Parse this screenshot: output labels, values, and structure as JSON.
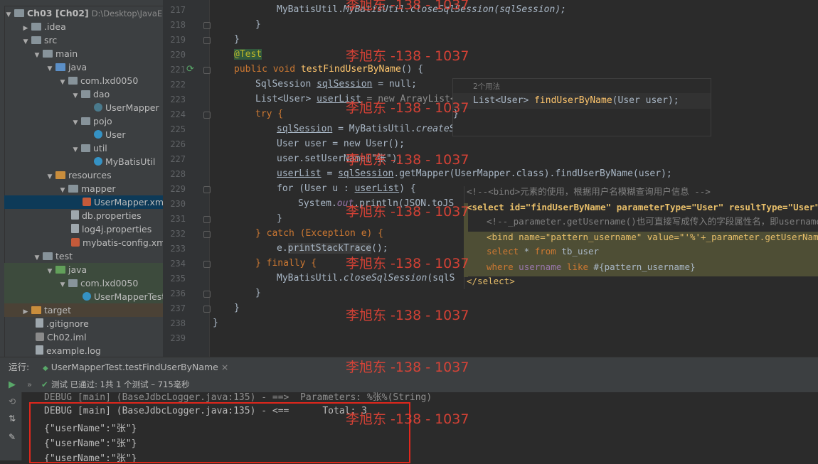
{
  "project_tree": {
    "root": {
      "name": "Ch03 [Ch02]",
      "path": "D:\\Desktop\\JavaEE\\"
    },
    "items": [
      {
        "label": ".idea"
      },
      {
        "label": "src"
      },
      {
        "label": "main"
      },
      {
        "label": "java"
      },
      {
        "label": "com.lxd0050"
      },
      {
        "label": "dao"
      },
      {
        "label": "UserMapper"
      },
      {
        "label": "pojo"
      },
      {
        "label": "User"
      },
      {
        "label": "util"
      },
      {
        "label": "MyBatisUtil"
      },
      {
        "label": "resources"
      },
      {
        "label": "mapper"
      },
      {
        "label": "UserMapper.xml"
      },
      {
        "label": "db.properties"
      },
      {
        "label": "log4j.properties"
      },
      {
        "label": "mybatis-config.xml"
      },
      {
        "label": "test"
      },
      {
        "label": "java"
      },
      {
        "label": "com.lxd0050"
      },
      {
        "label": "UserMapperTest"
      },
      {
        "label": "target"
      },
      {
        "label": ".gitignore"
      },
      {
        "label": "Ch02.iml"
      },
      {
        "label": "example.log"
      }
    ]
  },
  "editor": {
    "line_numbers": [
      "217",
      "218",
      "219",
      "220",
      "221",
      "222",
      "223",
      "224",
      "225",
      "226",
      "227",
      "228",
      "229",
      "230",
      "231",
      "232",
      "233",
      "234",
      "235",
      "236",
      "237",
      "238",
      "239"
    ],
    "code": {
      "l217": "MyBatisUtil.closeSqlSession(sqlSession);",
      "l218": "}",
      "l219": "}",
      "l220": "@Test",
      "l221_kw": "public void ",
      "l221_fn": "testFindUserByName",
      "l221_rest": "() {",
      "l222_type": "SqlSession ",
      "l222_var": "sqlSession",
      "l222_rest": " = null;",
      "l223_type": "List<User> ",
      "l223_var": "userList",
      "l223_rest": " = new ArrayList<",
      "l224": "try {",
      "l225_var": "sqlSession",
      "l225_rest": " = MyBatisUtil.",
      "l225_it": "createS",
      "l226": "User user = new User();",
      "l227": "user.setUserName(\"张\");",
      "l228_a": "userList",
      "l228_b": " = ",
      "l228_c": "sqlSession",
      "l228_d": ".getMapper(UserMapper.class).findUserByName(user);",
      "l229_a": "for (User u : ",
      "l229_b": "userList",
      "l229_c": ") {",
      "l230_a": "System.",
      "l230_b": "out",
      "l230_c": ".println(JSON.toJS",
      "l231": "}",
      "l232": "} catch (Exception e) {",
      "l233_a": "e.",
      "l233_b": "printStackTrace",
      "l233_c": "();",
      "l234": "} finally {",
      "l235_a": "MyBatisUtil.",
      "l235_b": "closeSqlSession",
      "l235_c": "(sqlS",
      "l236": "}",
      "l237": "}",
      "l238": "}"
    }
  },
  "usages_popup": {
    "hint": "2个用法",
    "signature_type": "List<User> ",
    "signature_fn": "findUserByName",
    "signature_rest": "(User user);"
  },
  "xml_popup": {
    "comment": "<!--<bind>元素的使用，根据用户名模糊查询用户信息 -->",
    "select_open": "<select id=\"findUserByName\" parameterType=\"User\" resultType=\"User\"",
    "inner_comment": "<!--_parameter.getUsername()也可直接写成传入的字段属性名，即username",
    "bind": "<bind name=\"pattern_username\" value=\"'%'+_parameter.getUserNam",
    "sql1_kw1": "select",
    "sql1_rest": " * ",
    "sql1_kw2": "from",
    "sql1_tbl": " tb_user",
    "sql2_kw": "where",
    "sql2_col": " username ",
    "sql2_kw2": "like",
    "sql2_param": " #{pattern_username}",
    "select_close": "</select>"
  },
  "run_panel": {
    "label": "运行:",
    "tab": "UserMapperTest.testFindUserByName",
    "status": "测试 已通过: 1共 1 个测试 – 715毫秒",
    "console": [
      "DEBUG [main] (BaseJdbcLogger.java:135) - ==>  Parameters: %张%(String)",
      "DEBUG [main] (BaseJdbcLogger.java:135) - <==      Total: 3",
      "{\"userName\":\"张\"}",
      "{\"userName\":\"张\"}",
      "{\"userName\":\"张\"}"
    ]
  },
  "watermark": "李旭东 -138 - 1037",
  "colors": {
    "accent": "#4a88c7",
    "highlight_box": "#e0271c",
    "watermark": "#e64437"
  }
}
